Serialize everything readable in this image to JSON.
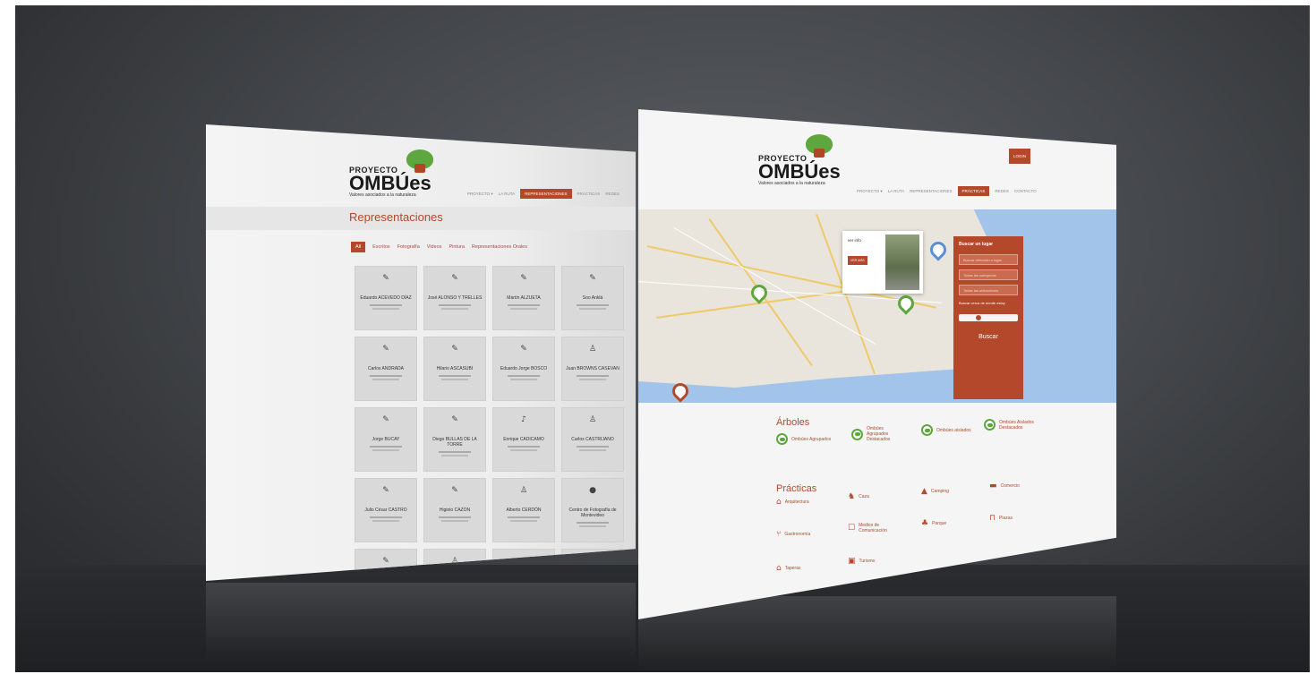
{
  "brand": {
    "proyecto": "PROYECTO",
    "name": "OMBÚes",
    "tagline": "Valores asociados a la naturaleza"
  },
  "left_screen": {
    "nav": [
      "PROYECTO ▾",
      "LA RUTA",
      "REPRESENTACIONES",
      "PRÁCTICAS",
      "REDES"
    ],
    "active_nav": "REPRESENTACIONES",
    "page_title": "Representaciones",
    "filters": [
      "All",
      "Escritos",
      "Fotografía",
      "Videos",
      "Pintura",
      "Representaciones Orales"
    ],
    "active_filter": "All",
    "cards": [
      {
        "icon": "book-icon",
        "glyph": "✎",
        "name": "Eduardo ACEVEDO DÍAZ"
      },
      {
        "icon": "book-icon",
        "glyph": "✎",
        "name": "José ALONSO Y TRELLES"
      },
      {
        "icon": "book-icon",
        "glyph": "✎",
        "name": "Martín ALZUETA"
      },
      {
        "icon": "book-icon",
        "glyph": "✎",
        "name": "Soo Anklá"
      },
      {
        "icon": "book-icon",
        "glyph": "✎",
        "name": "Carlos ANDRADA"
      },
      {
        "icon": "book-icon",
        "glyph": "✎",
        "name": "Hilario ASCASUBI"
      },
      {
        "icon": "book-icon",
        "glyph": "✎",
        "name": "Eduardo Jorge BOSCO"
      },
      {
        "icon": "person-icon",
        "glyph": "♙",
        "name": "Juan BROWNS CASEVAN"
      },
      {
        "icon": "book-icon",
        "glyph": "✎",
        "name": "Jorge BUCAY"
      },
      {
        "icon": "book-icon",
        "glyph": "✎",
        "name": "Diego BULLAS DE LA TORRE"
      },
      {
        "icon": "music-icon",
        "glyph": "♪",
        "name": "Enrique CADICAMO"
      },
      {
        "icon": "person-icon",
        "glyph": "♙",
        "name": "Carlos CASTRIJANO"
      },
      {
        "icon": "book-icon",
        "glyph": "✎",
        "name": "Julio César CASTRO"
      },
      {
        "icon": "book-icon",
        "glyph": "✎",
        "name": "Higinio CAZON"
      },
      {
        "icon": "person-icon",
        "glyph": "♙",
        "name": "Alberto CERDÓN"
      },
      {
        "icon": "camera-icon",
        "glyph": "●",
        "name": "Centro de Fotografía de Montevideo"
      },
      {
        "icon": "book-icon",
        "glyph": "✎",
        "name": ""
      },
      {
        "icon": "person-icon",
        "glyph": "♙",
        "name": ""
      },
      {
        "icon": "book-icon",
        "glyph": "✎",
        "name": ""
      },
      {
        "icon": "person-icon",
        "glyph": "♙",
        "name": ""
      }
    ]
  },
  "right_screen": {
    "nav": [
      "PROYECTO ▾",
      "LA RUTA",
      "REPRESENTACIONES",
      "PRÁCTICAS",
      "REDES",
      "CONTACTO"
    ],
    "active_nav": "PRÁCTICAS",
    "login": "LOGIN",
    "infowindow": {
      "title": "ver info",
      "button": "VER MÁS"
    },
    "search": {
      "title": "Buscar un lugar",
      "fields": [
        "Buscar dirección o lugar",
        "Todas las categorías",
        "Todas las ubicaciones"
      ],
      "near_label": "Buscar cerca de donde estoy",
      "button": "Buscar"
    },
    "arboles_title": "Árboles",
    "arboles": [
      "Ombúes Agrupados",
      "Ombúes Agrupados Destacados",
      "Ombúes aislados",
      "Ombúes Aislados Destacados"
    ],
    "practicas_title": "Prácticas",
    "practicas": [
      {
        "icon": "museum-icon",
        "glyph": "⌂",
        "label": "Arquitectura"
      },
      {
        "icon": "horse-icon",
        "glyph": "♞",
        "label": "Caza"
      },
      {
        "icon": "camp-icon",
        "glyph": "▲",
        "label": "Camping"
      },
      {
        "icon": "store-icon",
        "glyph": "▬",
        "label": "Comercio"
      },
      {
        "icon": "food-icon",
        "glyph": "⑂",
        "label": "Gastronomía"
      },
      {
        "icon": "media-icon",
        "glyph": "☐",
        "label": "Medios de Comunicación"
      },
      {
        "icon": "park-icon",
        "glyph": "♣",
        "label": "Parque"
      },
      {
        "icon": "bench-icon",
        "glyph": "⊓",
        "label": "Plazas"
      },
      {
        "icon": "home-icon",
        "glyph": "⌂",
        "label": "Taperas"
      },
      {
        "icon": "bag-icon",
        "glyph": "▣",
        "label": "Turismo"
      }
    ]
  },
  "colors": {
    "accent": "#b3482b",
    "green": "#5ea63e"
  }
}
